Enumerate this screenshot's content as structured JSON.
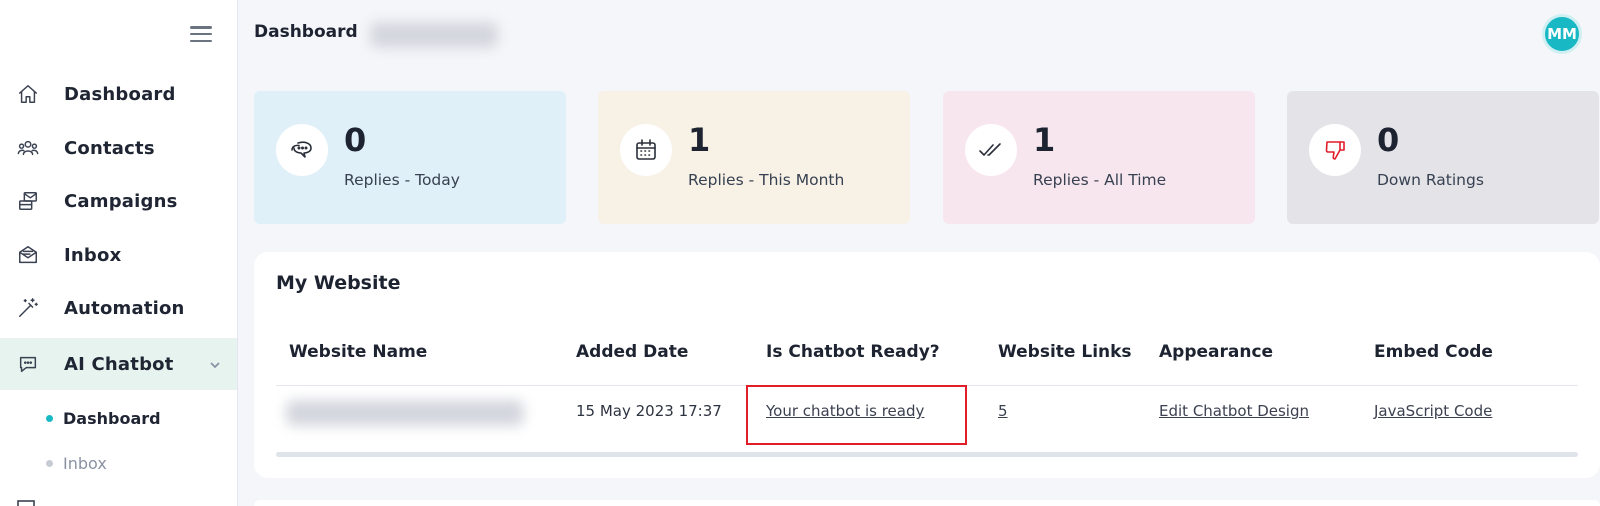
{
  "header": {
    "title": "Dashboard",
    "avatar_initials": "MM",
    "avatar_color": "#18b8c4"
  },
  "sidebar": {
    "items": [
      {
        "label": "Dashboard",
        "icon": "home-icon"
      },
      {
        "label": "Contacts",
        "icon": "users-icon"
      },
      {
        "label": "Campaigns",
        "icon": "campaigns-icon"
      },
      {
        "label": "Inbox",
        "icon": "inbox-icon"
      },
      {
        "label": "Automation",
        "icon": "magic-wand-icon"
      },
      {
        "label": "AI Chatbot",
        "icon": "chat-bubble-icon",
        "active": true,
        "expanded": true
      }
    ],
    "subitems": [
      {
        "label": "Dashboard",
        "active": true
      },
      {
        "label": "Inbox",
        "active": false
      }
    ],
    "active_bg": "#e6f3ee",
    "active_dot": "#18b8c4"
  },
  "stats": [
    {
      "value": "0",
      "caption": "Replies - Today",
      "icon": "chat-icon",
      "bg": "#dff0f8"
    },
    {
      "value": "1",
      "caption": "Replies - This Month",
      "icon": "calendar-icon",
      "bg": "#f7f1e6"
    },
    {
      "value": "1",
      "caption": "Replies - All Time",
      "icon": "double-check-icon",
      "bg": "#f8e6ef"
    },
    {
      "value": "0",
      "caption": "Down Ratings",
      "icon": "thumbs-down-icon",
      "bg": "#e3e3e8"
    }
  ],
  "website_panel": {
    "title": "My Website",
    "columns": [
      "Website Name",
      "Added Date",
      "Is Chatbot Ready?",
      "Website Links",
      "Appearance",
      "Embed Code"
    ],
    "rows": [
      {
        "added_date": "15 May 2023 17:37",
        "chatbot_ready": "Your chatbot is ready",
        "website_links": "5",
        "appearance": "Edit Chatbot Design",
        "embed_code": "JavaScript Code"
      }
    ]
  }
}
